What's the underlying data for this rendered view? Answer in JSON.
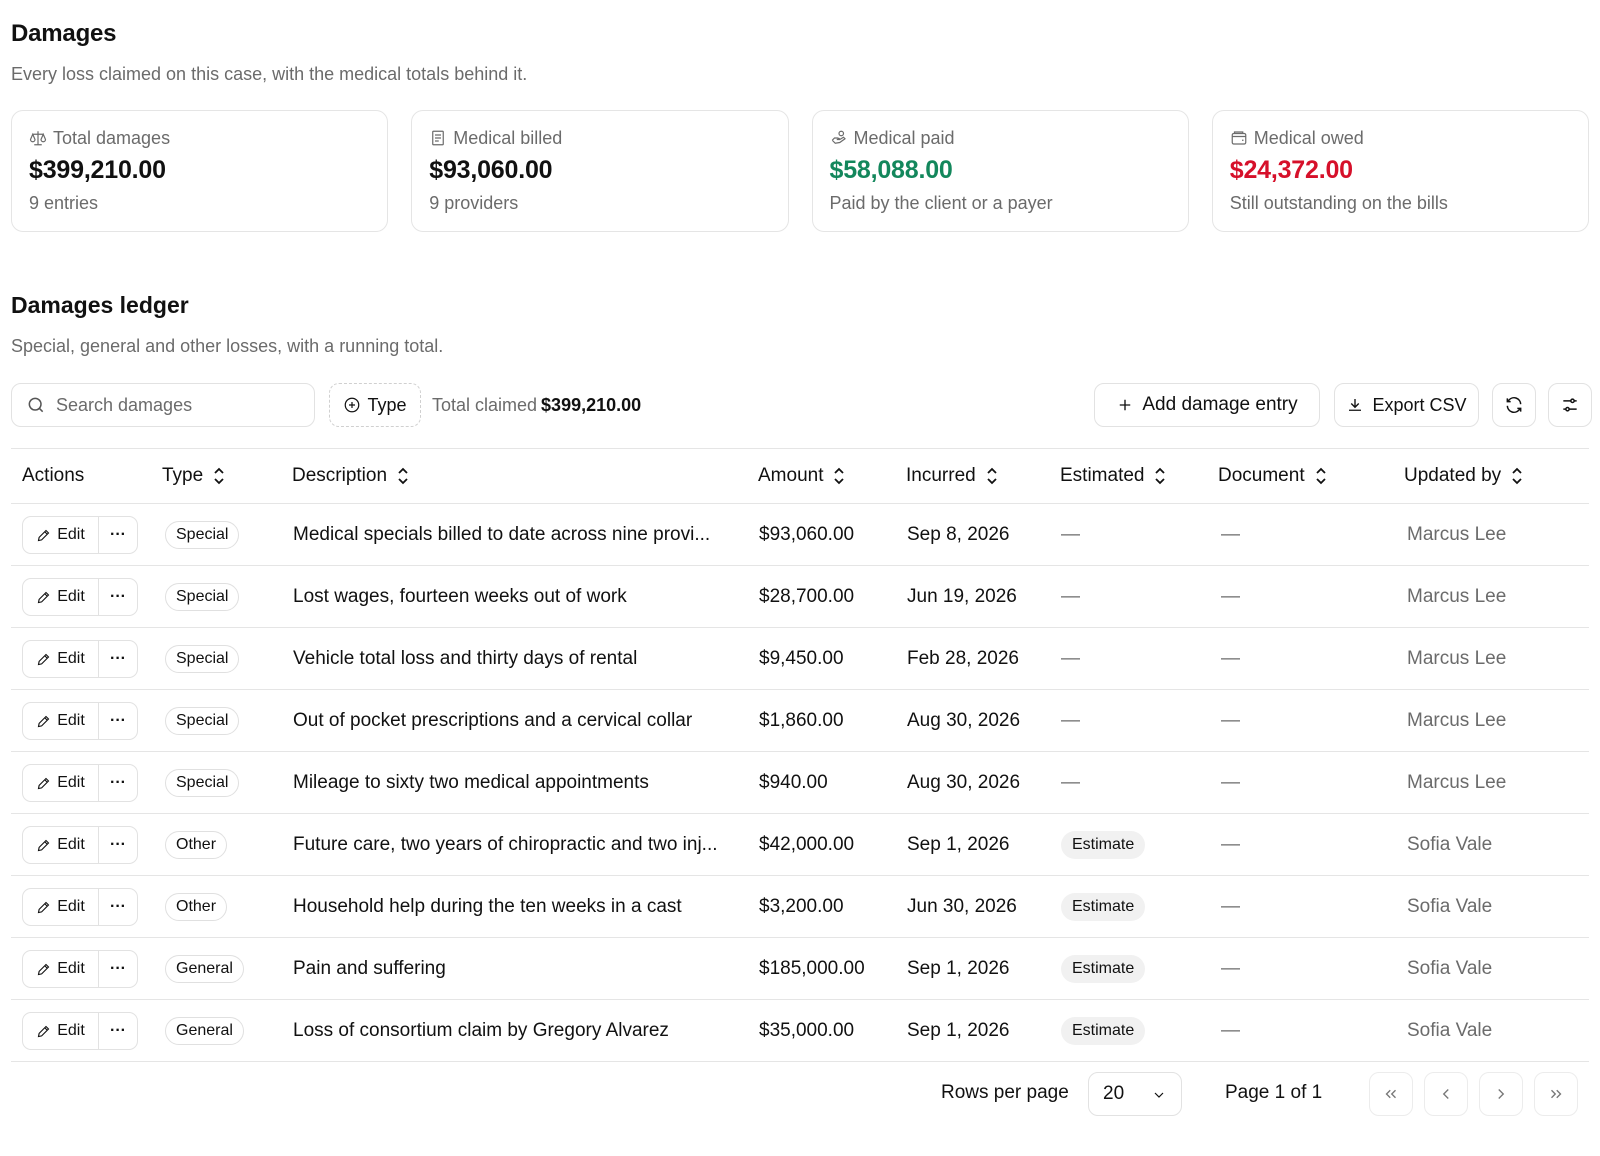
{
  "header": {
    "title": "Damages",
    "subtitle": "Every loss claimed on this case, with the medical totals behind it."
  },
  "cards": [
    {
      "label": "Total damages",
      "value": "$399,210.00",
      "foot": "9 entries",
      "icon": "scale-icon",
      "tone": "default"
    },
    {
      "label": "Medical billed",
      "value": "$93,060.00",
      "foot": "9 providers",
      "icon": "receipt-icon",
      "tone": "default"
    },
    {
      "label": "Medical paid",
      "value": "$58,088.00",
      "foot": "Paid by the client or a payer",
      "icon": "hand-coins-icon",
      "tone": "green"
    },
    {
      "label": "Medical owed",
      "value": "$24,372.00",
      "foot": "Still outstanding on the bills",
      "icon": "wallet-icon",
      "tone": "red"
    }
  ],
  "ledger": {
    "title": "Damages ledger",
    "subtitle": "Special, general and other losses, with a running total."
  },
  "toolbar": {
    "search_placeholder": "Search damages",
    "type_filter": "Type",
    "total_label": "Total claimed",
    "total_value": "$399,210.00",
    "add_label": "Add damage entry",
    "export_label": "Export CSV"
  },
  "table": {
    "columns": [
      "Actions",
      "Type",
      "Description",
      "Amount",
      "Incurred",
      "Estimated",
      "Document",
      "Updated by"
    ],
    "edit_label": "Edit",
    "more_label": "···",
    "dash": "—",
    "rows": [
      {
        "type": "Special",
        "description": "Medical specials billed to date across nine provi...",
        "amount": "$93,060.00",
        "incurred": "Sep 8, 2026",
        "estimated": "—",
        "document": "—",
        "updated_by": "Marcus Lee"
      },
      {
        "type": "Special",
        "description": "Lost wages, fourteen weeks out of work",
        "amount": "$28,700.00",
        "incurred": "Jun 19, 2026",
        "estimated": "—",
        "document": "—",
        "updated_by": "Marcus Lee"
      },
      {
        "type": "Special",
        "description": "Vehicle total loss and thirty days of rental",
        "amount": "$9,450.00",
        "incurred": "Feb 28, 2026",
        "estimated": "—",
        "document": "—",
        "updated_by": "Marcus Lee"
      },
      {
        "type": "Special",
        "description": "Out of pocket prescriptions and a cervical collar",
        "amount": "$1,860.00",
        "incurred": "Aug 30, 2026",
        "estimated": "—",
        "document": "—",
        "updated_by": "Marcus Lee"
      },
      {
        "type": "Special",
        "description": "Mileage to sixty two medical appointments",
        "amount": "$940.00",
        "incurred": "Aug 30, 2026",
        "estimated": "—",
        "document": "—",
        "updated_by": "Marcus Lee"
      },
      {
        "type": "Other",
        "description": "Future care, two years of chiropractic and two inj...",
        "amount": "$42,000.00",
        "incurred": "Sep 1, 2026",
        "estimated": "Estimate",
        "document": "—",
        "updated_by": "Sofia Vale"
      },
      {
        "type": "Other",
        "description": "Household help during the ten weeks in a cast",
        "amount": "$3,200.00",
        "incurred": "Jun 30, 2026",
        "estimated": "Estimate",
        "document": "—",
        "updated_by": "Sofia Vale"
      },
      {
        "type": "General",
        "description": "Pain and suffering",
        "amount": "$185,000.00",
        "incurred": "Sep 1, 2026",
        "estimated": "Estimate",
        "document": "—",
        "updated_by": "Sofia Vale"
      },
      {
        "type": "General",
        "description": "Loss of consortium claim by Gregory Alvarez",
        "amount": "$35,000.00",
        "incurred": "Sep 1, 2026",
        "estimated": "Estimate",
        "document": "—",
        "updated_by": "Sofia Vale"
      }
    ]
  },
  "pagination": {
    "rows_label": "Rows per page",
    "rows_value": "20",
    "page_label": "Page 1 of 1"
  },
  "colors": {
    "green": "#13875c",
    "red": "#d6102a",
    "muted": "#6b6b6b",
    "border": "#e5e5e5"
  }
}
